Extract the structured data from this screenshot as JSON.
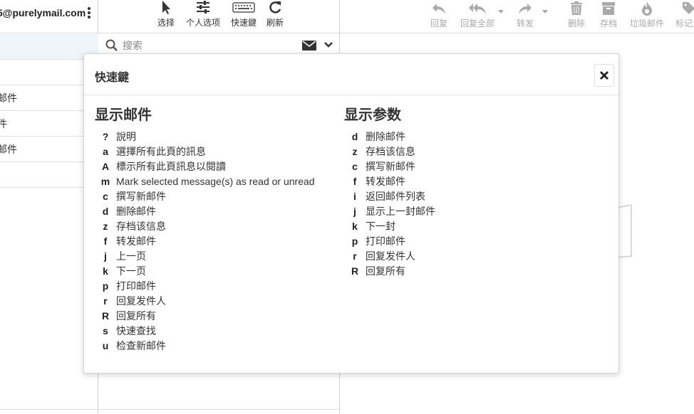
{
  "account": {
    "email": "5@purelymail.com"
  },
  "folders": [
    "",
    "",
    "邮件",
    "件",
    "邮件",
    ""
  ],
  "mid_toolbar": [
    {
      "icon": "pointer-icon",
      "label": "选择"
    },
    {
      "icon": "sliders-icon",
      "label": "个人选项"
    },
    {
      "icon": "keyboard-icon",
      "label": "快速鍵"
    },
    {
      "icon": "refresh-icon",
      "label": "刷新"
    }
  ],
  "search": {
    "placeholder": "搜索"
  },
  "right_toolbar": [
    {
      "icon": "reply-icon",
      "label": "回复"
    },
    {
      "icon": "reply-all-icon",
      "label": "回复全部"
    },
    {
      "icon": "forward-icon",
      "label": "转发"
    },
    {
      "icon": "trash-icon",
      "label": "删除"
    },
    {
      "icon": "archive-icon",
      "label": "存档"
    },
    {
      "icon": "fire-icon",
      "label": "垃圾邮件"
    },
    {
      "icon": "tag-icon",
      "label": "标记为"
    }
  ],
  "dialog": {
    "title": "快速鍵",
    "left": {
      "heading": "显示邮件",
      "rows": [
        {
          "key": "?",
          "desc": "說明"
        },
        {
          "key": "a",
          "desc": "選擇所有此頁的訊息"
        },
        {
          "key": "A",
          "desc": "標示所有此頁訊息以閱讀"
        },
        {
          "key": "m",
          "desc": "Mark selected message(s) as read or unread"
        },
        {
          "key": "c",
          "desc": "撰写新邮件"
        },
        {
          "key": "d",
          "desc": "删除邮件"
        },
        {
          "key": "z",
          "desc": "存档该信息"
        },
        {
          "key": "f",
          "desc": "转发邮件"
        },
        {
          "key": "j",
          "desc": "上一页"
        },
        {
          "key": "k",
          "desc": "下一页"
        },
        {
          "key": "p",
          "desc": "打印邮件"
        },
        {
          "key": "r",
          "desc": "回复发件人"
        },
        {
          "key": "R",
          "desc": "回复所有"
        },
        {
          "key": "s",
          "desc": "快速查找"
        },
        {
          "key": "u",
          "desc": "检查新邮件"
        }
      ]
    },
    "right": {
      "heading": "显示参数",
      "rows": [
        {
          "key": "d",
          "desc": "删除邮件"
        },
        {
          "key": "z",
          "desc": "存档该信息"
        },
        {
          "key": "c",
          "desc": "撰写新邮件"
        },
        {
          "key": "f",
          "desc": "转发邮件"
        },
        {
          "key": "i",
          "desc": "返回邮件列表"
        },
        {
          "key": "j",
          "desc": "显示上一封邮件"
        },
        {
          "key": "k",
          "desc": "下一封"
        },
        {
          "key": "p",
          "desc": "打印邮件"
        },
        {
          "key": "r",
          "desc": "回复发件人"
        },
        {
          "key": "R",
          "desc": "回复所有"
        }
      ]
    }
  },
  "colors": {
    "active_folder_bg": "#eef6fc",
    "disabled_text": "#aaaaaa"
  }
}
